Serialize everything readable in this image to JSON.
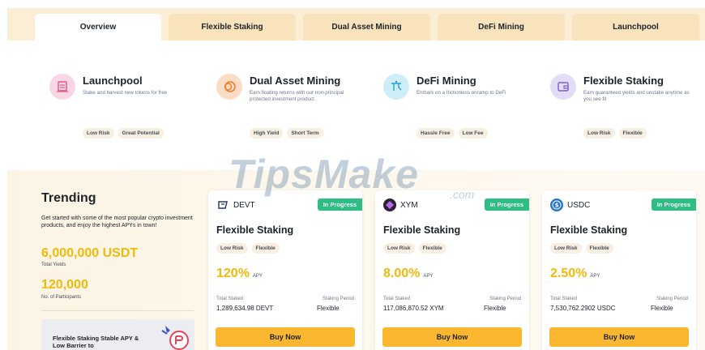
{
  "tabs": [
    "Overview",
    "Flexible Staking",
    "Dual Asset Mining",
    "DeFi Mining",
    "Launchpool"
  ],
  "products": [
    {
      "title": "Launchpool",
      "desc": "Stake and harvest new tokens for free",
      "tags": [
        "Low Risk",
        "Great Potential"
      ],
      "icon": "launchpool-icon",
      "icon_bg": "#f9d6e6"
    },
    {
      "title": "Dual Asset Mining",
      "desc": "Earn floating returns with our non-principal protected investment product",
      "tags": [
        "High Yield",
        "Short Term"
      ],
      "icon": "dual-asset-icon",
      "icon_bg": "#fcdcc4"
    },
    {
      "title": "DeFi Mining",
      "desc": "Embark on a frictionless onramp to DeFi",
      "tags": [
        "Hassle Free",
        "Low Fee"
      ],
      "icon": "defi-icon",
      "icon_bg": "#cdeef8"
    },
    {
      "title": "Flexible Staking",
      "desc": "Earn guaranteed yields and unstake anytime as you see fit",
      "tags": [
        "Low Risk",
        "Flexible"
      ],
      "icon": "wallet-icon",
      "icon_bg": "#e3dcf6"
    }
  ],
  "trending": {
    "title": "Trending",
    "desc": "Get started with some of the most popular crypto investment products, and enjoy the highest APYs in town!",
    "total_yields": "6,000,000 USDT",
    "total_yields_label": "Total Yields",
    "participants": "120,000",
    "participants_label": "No. of Participants",
    "promo": "Flexible Staking Stable APY & Low Barrier to"
  },
  "cards": [
    {
      "coin": "DEVT",
      "badge": "In Progress",
      "title": "Flexible Staking",
      "tags": [
        "Low Risk",
        "Flexible"
      ],
      "apy": "120%",
      "apy_label": "APY",
      "staked_label": "Total Staked",
      "staked": "1,289,634.98 DEVT",
      "period_label": "Staking Period",
      "period": "Flexible",
      "button": "Buy Now"
    },
    {
      "coin": "XYM",
      "badge": "In Progress",
      "title": "Flexible Staking",
      "tags": [
        "Low Risk",
        "Flexible"
      ],
      "apy": "8.00%",
      "apy_label": "APY",
      "staked_label": "Total Staked",
      "staked": "117,086,870.52 XYM",
      "period_label": "Staking Period",
      "period": "Flexible",
      "button": "Buy Now"
    },
    {
      "coin": "USDC",
      "badge": "In Progress",
      "title": "Flexible Staking",
      "tags": [
        "Low Risk",
        "Flexible"
      ],
      "apy": "2.50%",
      "apy_label": "APY",
      "staked_label": "Total Staked",
      "staked": "7,530,762.2902 USDC",
      "period_label": "Staking Period",
      "period": "Flexible",
      "button": "Buy Now"
    }
  ],
  "watermark": {
    "main": "TipsMake",
    "sub": ".com"
  },
  "colors": {
    "accent": "#f0b90b",
    "button": "#fcb731",
    "badge": "#2ebd85",
    "tab_bar": "#fbeed4"
  }
}
